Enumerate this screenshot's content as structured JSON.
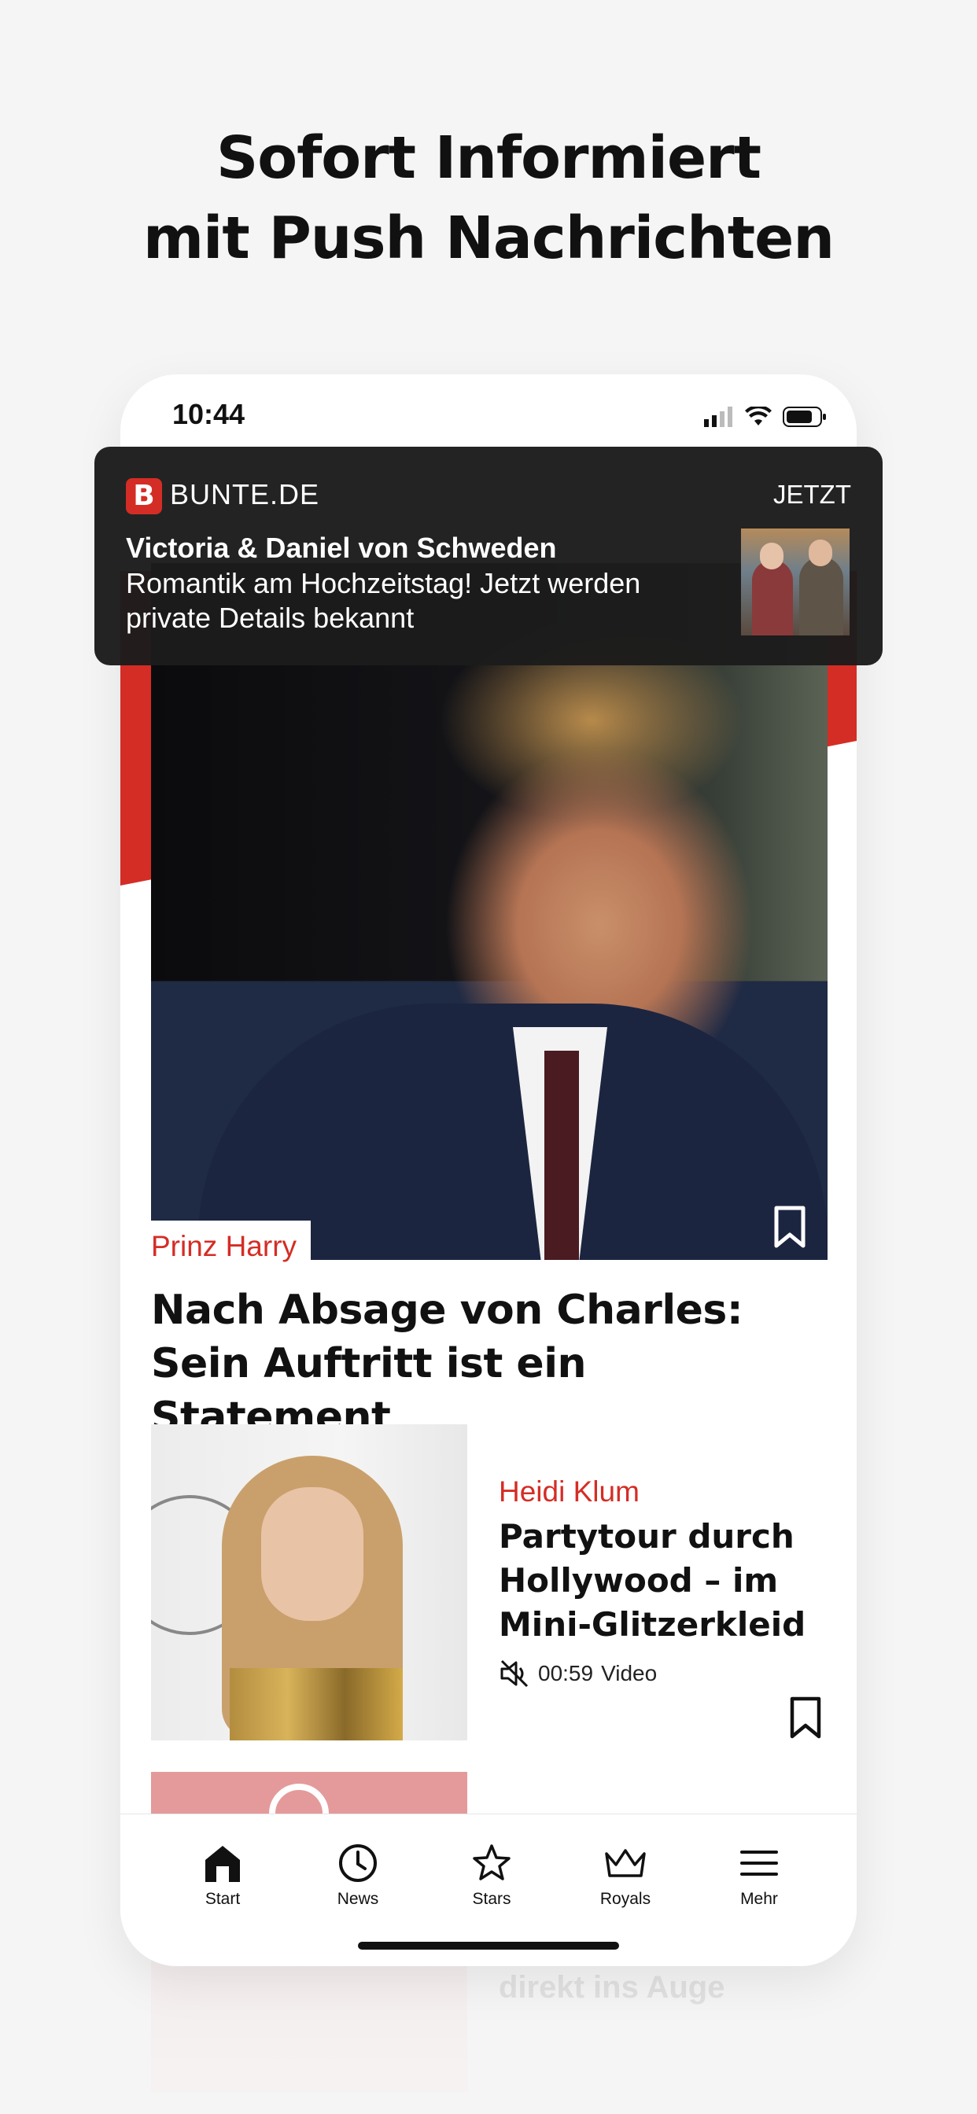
{
  "promo": {
    "line1": "Sofort Informiert",
    "line2": "mit Push Nachrichten"
  },
  "status_bar": {
    "time": "10:44"
  },
  "notification": {
    "app_logo_letter": "B",
    "app_name": "BUNTE.DE",
    "time": "JETZT",
    "title": "Victoria & Daniel von Schweden",
    "body": "Romantik am Hochzeitstag! Jetzt werden private Details bekannt"
  },
  "hero_article": {
    "tag": "Prinz Harry",
    "title": "Nach Absage von Charles: Sein Auftritt ist ein Statement"
  },
  "article2": {
    "tag": "Heidi Klum",
    "title": "Partytour durch Hollywood – im Mini-Glitzerkleid",
    "duration": "00:59",
    "media_type": "Video"
  },
  "peek_text": "direkt ins Auge",
  "tabbar": {
    "items": [
      {
        "label": "Start",
        "icon": "home-icon"
      },
      {
        "label": "News",
        "icon": "clock-icon"
      },
      {
        "label": "Stars",
        "icon": "star-icon"
      },
      {
        "label": "Royals",
        "icon": "crown-icon"
      },
      {
        "label": "Mehr",
        "icon": "menu-icon"
      }
    ]
  },
  "colors": {
    "accent": "#d42d25",
    "notification_bg": "#1c1c1c"
  }
}
